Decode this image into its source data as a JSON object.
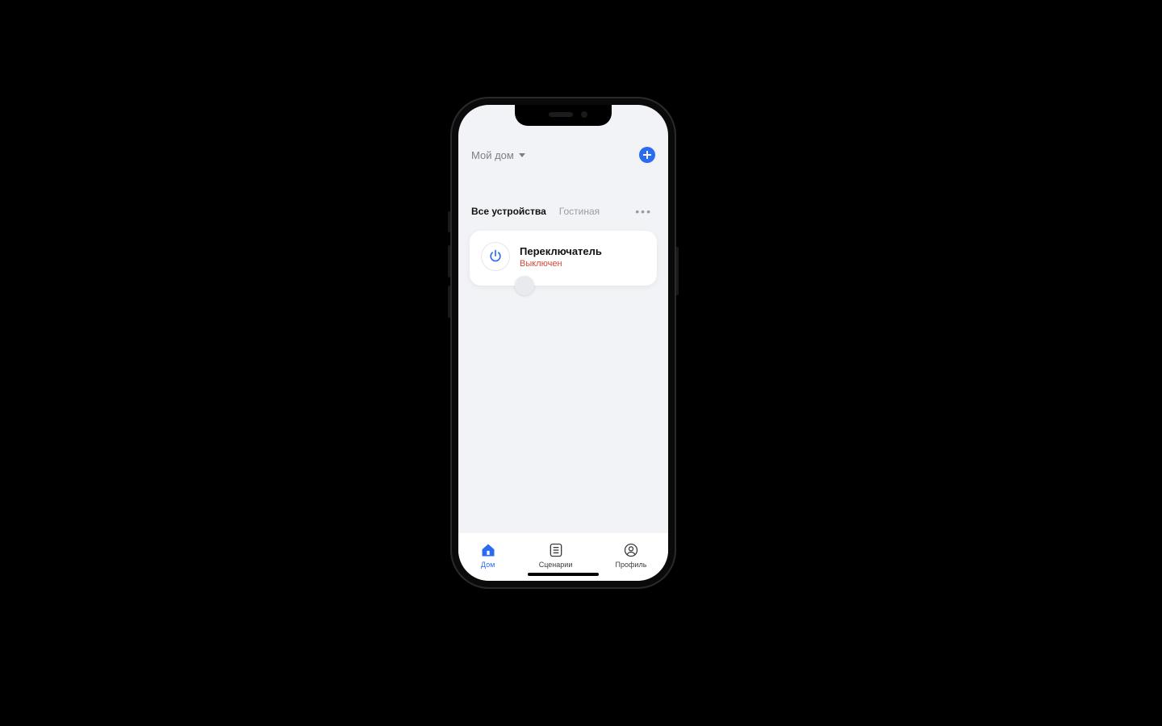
{
  "header": {
    "house_label": "Мой дом"
  },
  "tabs": {
    "all_devices": "Все устройства",
    "room1": "Гостиная"
  },
  "device": {
    "title": "Переключатель",
    "status": "Выключен"
  },
  "tabbar": {
    "home": "Дом",
    "scenarios": "Сценарии",
    "profile": "Профиль"
  },
  "colors": {
    "accent": "#2a6bf2",
    "status_off": "#d0493a"
  }
}
